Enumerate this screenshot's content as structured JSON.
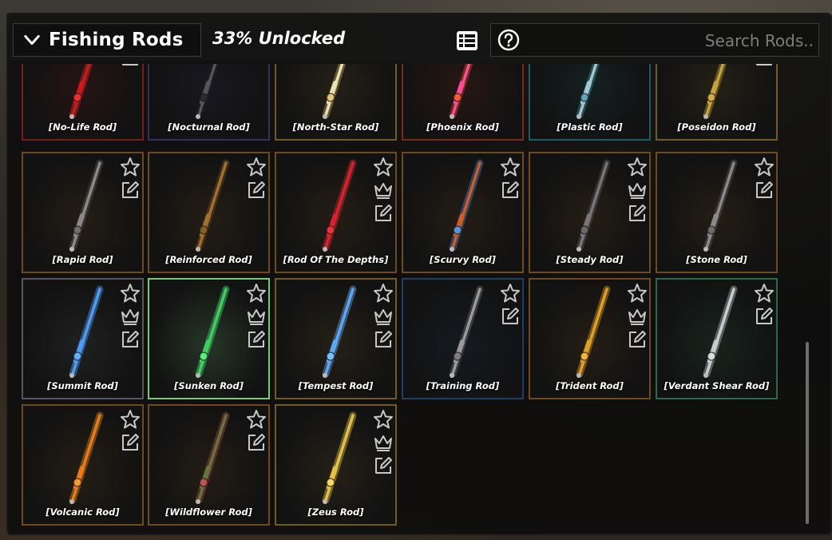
{
  "header": {
    "title": "Fishing Rods",
    "unlocked_text": "33% Unlocked",
    "search_placeholder": "Search Rods.."
  },
  "icons": {
    "collapse": "chevron-down-icon",
    "list_view": "list-view-icon",
    "help": "help-circle-icon",
    "favorite": "star-icon",
    "equipped": "crown-icon",
    "edit": "edit-icon"
  },
  "rods": [
    {
      "name": "[No-Life Rod]",
      "border": "#7a1c1c",
      "rod": "#d01818",
      "glow": "#ff3030",
      "star": false,
      "crown": false,
      "edit": true
    },
    {
      "name": "[Nocturnal Rod]",
      "border": "#35305e",
      "rod": "#555",
      "glow": "#222",
      "star": false,
      "crown": false,
      "edit": false
    },
    {
      "name": "[North-Star Rod]",
      "border": "#6e5a2a",
      "rod": "#e8e2b0",
      "glow": "#e6c070",
      "star": false,
      "crown": false,
      "edit": false
    },
    {
      "name": "[Phoenix Rod]",
      "border": "#7a2a1a",
      "rod": "#ff4aa0",
      "glow": "#ff5a1e",
      "star": false,
      "crown": false,
      "edit": false
    },
    {
      "name": "[Plastic Rod]",
      "border": "#1f5a62",
      "rod": "#9fc8d0",
      "glow": "#4fa0b0",
      "star": false,
      "crown": false,
      "edit": false
    },
    {
      "name": "[Poseidon Rod]",
      "border": "#6e5a2a",
      "rod": "#c8a23a",
      "glow": "#d8b040",
      "star": false,
      "crown": false,
      "edit": true
    },
    {
      "name": "[Rapid Rod]",
      "border": "#6e4a20",
      "rod": "#8a8a8a",
      "glow": "#666",
      "star": true,
      "crown": false,
      "edit": true
    },
    {
      "name": "[Reinforced Rod]",
      "border": "#6e4a20",
      "rod": "#a0702e",
      "glow": "#8a5a20",
      "star": true,
      "crown": false,
      "edit": true
    },
    {
      "name": "[Rod Of The Depths]",
      "border": "#6e4a20",
      "rod": "#e01e2e",
      "glow": "#ff3040",
      "star": true,
      "crown": true,
      "edit": true
    },
    {
      "name": "[Scurvy Rod]",
      "border": "#6e4a20",
      "rod": "#d85a1e",
      "glow": "#40a0ff",
      "star": true,
      "crown": false,
      "edit": true
    },
    {
      "name": "[Steady Rod]",
      "border": "#6e4a20",
      "rod": "#777",
      "glow": "#666",
      "star": true,
      "crown": true,
      "edit": true
    },
    {
      "name": "[Stone Rod]",
      "border": "#6e4a20",
      "rod": "#8a8a8a",
      "glow": "#666",
      "star": true,
      "crown": false,
      "edit": true
    },
    {
      "name": "[Summit Rod]",
      "border": "#55585e",
      "rod": "#4a9cff",
      "glow": "#60b8ff",
      "star": true,
      "crown": true,
      "edit": true
    },
    {
      "name": "[Sunken Rod]",
      "border": "#7ac87a",
      "rod": "#3cd060",
      "glow": "#50ff80",
      "star": true,
      "crown": true,
      "edit": true
    },
    {
      "name": "[Tempest Rod]",
      "border": "#6e5a2a",
      "rod": "#58a8ff",
      "glow": "#80c8ff",
      "star": true,
      "crown": true,
      "edit": true
    },
    {
      "name": "[Training Rod]",
      "border": "#203e5e",
      "rod": "#999",
      "glow": "#777",
      "star": true,
      "crown": false,
      "edit": true
    },
    {
      "name": "[Trident Rod]",
      "border": "#6e4a20",
      "rod": "#e0a020",
      "glow": "#ffb830",
      "star": true,
      "crown": true,
      "edit": true
    },
    {
      "name": "[Verdant Shear Rod]",
      "border": "#2a6a4a",
      "rod": "#c8ccd0",
      "glow": "#e0e0e0",
      "star": true,
      "crown": false,
      "edit": true
    },
    {
      "name": "[Volcanic Rod]",
      "border": "#6e4a20",
      "rod": "#f07a10",
      "glow": "#ffa030",
      "star": true,
      "crown": false,
      "edit": true
    },
    {
      "name": "[Wildflower Rod]",
      "border": "#6e4a20",
      "rod": "#5e7a3a",
      "glow": "#d84a5a",
      "star": true,
      "crown": false,
      "edit": true
    },
    {
      "name": "[Zeus Rod]",
      "border": "#6e5a2a",
      "rod": "#e8c040",
      "glow": "#ffe060",
      "star": true,
      "crown": true,
      "edit": true
    }
  ]
}
